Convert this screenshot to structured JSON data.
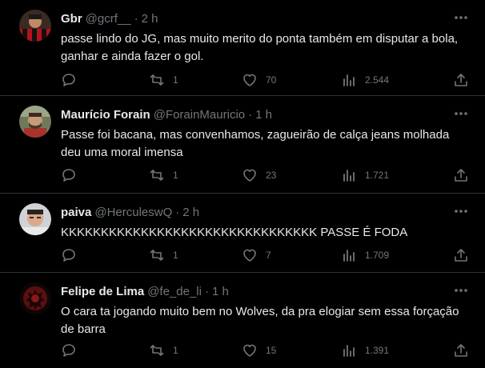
{
  "tweets": [
    {
      "name": "Gbr",
      "handle": "@gcrf__",
      "time": "2 h",
      "text": "passe lindo do JG, mas muito merito do ponta também em disputar a bola, ganhar e ainda fazer o gol.",
      "replies": "",
      "retweets": "1",
      "likes": "70",
      "views": "2.544"
    },
    {
      "name": "Maurício Forain",
      "handle": "@ForainMauricio",
      "time": "1 h",
      "text": "Passe foi bacana, mas convenhamos, zagueirão de calça jeans molhada deu uma moral imensa",
      "replies": "",
      "retweets": "1",
      "likes": "23",
      "views": "1.721"
    },
    {
      "name": "paiva",
      "handle": "@HerculeswQ",
      "time": "2 h",
      "text": "KKKKKKKKKKKKKKKKKKKKKKKKKKKKKKKK PASSE É FODA",
      "replies": "",
      "retweets": "1",
      "likes": "7",
      "views": "1.709"
    },
    {
      "name": "Felipe de Lima",
      "handle": "@fe_de_li",
      "time": "1 h",
      "text": "O cara ta jogando muito bem no Wolves, da pra elogiar sem essa forçação de barra",
      "replies": "",
      "retweets": "1",
      "likes": "15",
      "views": "1.391"
    }
  ],
  "separator": "·",
  "icons": {
    "more": "more-horizontal-icon",
    "reply": "reply-bubble-icon",
    "retweet": "retweet-icon",
    "like": "heart-icon",
    "views": "bar-chart-views-icon",
    "share": "share-upload-icon"
  },
  "colors": {
    "background": "#000000",
    "text": "#e7e9ea",
    "secondary": "#71767b",
    "divider": "#2f3336"
  }
}
